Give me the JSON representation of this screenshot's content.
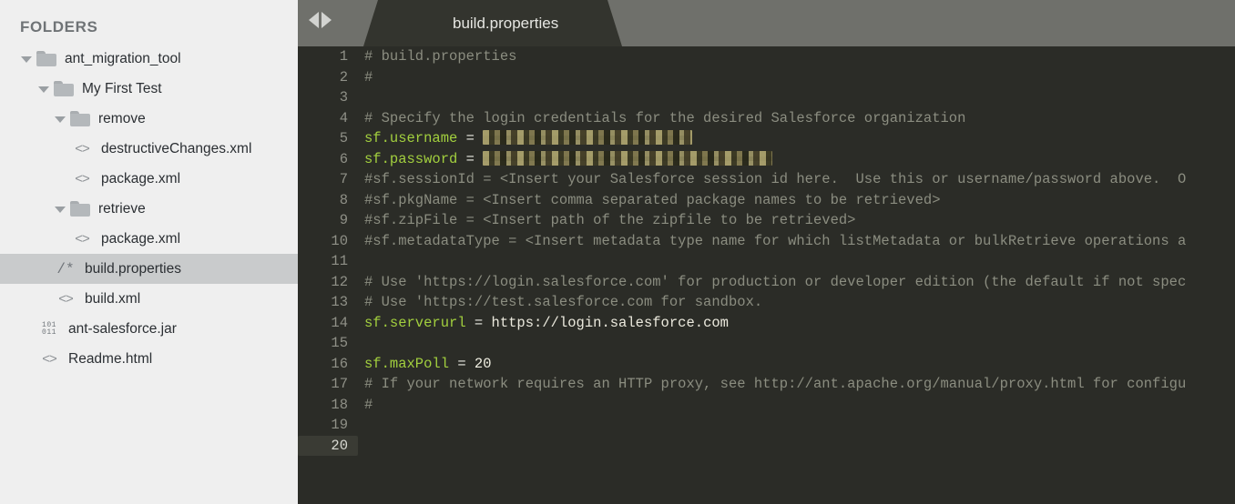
{
  "sidebar": {
    "title": "FOLDERS",
    "items": [
      {
        "label": "ant_migration_tool",
        "icon": "folder-icon",
        "indent": 0,
        "type": "folder",
        "expanded": true,
        "selected": false
      },
      {
        "label": "My First Test",
        "icon": "folder-icon",
        "indent": 1,
        "type": "folder",
        "expanded": true,
        "selected": false
      },
      {
        "label": "remove",
        "icon": "folder-icon",
        "indent": 2,
        "type": "folder",
        "expanded": true,
        "selected": false
      },
      {
        "label": "destructiveChanges.xml",
        "icon": "code-file-icon",
        "indent": 3,
        "type": "file",
        "expanded": false,
        "selected": false
      },
      {
        "label": "package.xml",
        "icon": "code-file-icon",
        "indent": 3,
        "type": "file",
        "expanded": false,
        "selected": false
      },
      {
        "label": "retrieve",
        "icon": "folder-icon",
        "indent": 2,
        "type": "folder",
        "expanded": true,
        "selected": false
      },
      {
        "label": "package.xml",
        "icon": "code-file-icon",
        "indent": 3,
        "type": "file",
        "expanded": false,
        "selected": false
      },
      {
        "label": "build.properties",
        "icon": "properties-file-icon",
        "indent": 2,
        "type": "file",
        "expanded": false,
        "selected": true
      },
      {
        "label": "build.xml",
        "icon": "code-file-icon",
        "indent": 2,
        "type": "file",
        "expanded": false,
        "selected": false
      },
      {
        "label": "ant-salesforce.jar",
        "icon": "binary-file-icon",
        "indent": 1,
        "type": "file",
        "expanded": false,
        "selected": false
      },
      {
        "label": "Readme.html",
        "icon": "code-file-icon",
        "indent": 1,
        "type": "file",
        "expanded": false,
        "selected": false
      }
    ],
    "icon_glyphs": {
      "code-file-icon": "<>",
      "properties-file-icon": "/*",
      "binary-file-icon_top": "101",
      "binary-file-icon_bottom": "011"
    }
  },
  "tabbar": {
    "nav_prev_icon": "arrow-left-icon",
    "nav_next_icon": "arrow-right-icon",
    "tabs": [
      {
        "label": "build.properties",
        "active": true,
        "close_icon": "×"
      }
    ]
  },
  "editor": {
    "active_line": 20,
    "line_numbers": [
      1,
      2,
      3,
      4,
      5,
      6,
      7,
      8,
      9,
      10,
      11,
      12,
      13,
      14,
      15,
      16,
      17,
      18,
      19,
      20
    ],
    "lines": [
      {
        "n": 1,
        "tokens": [
          {
            "t": "comment",
            "v": "# build.properties"
          }
        ]
      },
      {
        "n": 2,
        "tokens": [
          {
            "t": "comment",
            "v": "#"
          }
        ]
      },
      {
        "n": 3,
        "tokens": []
      },
      {
        "n": 4,
        "tokens": [
          {
            "t": "comment",
            "v": "# Specify the login credentials for the desired Salesforce organization"
          }
        ]
      },
      {
        "n": 5,
        "tokens": [
          {
            "t": "key",
            "v": "sf.username"
          },
          {
            "t": "eq",
            "v": " = "
          },
          {
            "t": "redacted",
            "v": "",
            "width": "user"
          }
        ]
      },
      {
        "n": 6,
        "tokens": [
          {
            "t": "key",
            "v": "sf.password"
          },
          {
            "t": "eq",
            "v": " = "
          },
          {
            "t": "redacted",
            "v": "",
            "width": "pass"
          }
        ]
      },
      {
        "n": 7,
        "tokens": [
          {
            "t": "comment",
            "v": "#sf.sessionId = <Insert your Salesforce session id here.  Use this or username/password above.  O"
          }
        ]
      },
      {
        "n": 8,
        "tokens": [
          {
            "t": "comment",
            "v": "#sf.pkgName = <Insert comma separated package names to be retrieved>"
          }
        ]
      },
      {
        "n": 9,
        "tokens": [
          {
            "t": "comment",
            "v": "#sf.zipFile = <Insert path of the zipfile to be retrieved>"
          }
        ]
      },
      {
        "n": 10,
        "tokens": [
          {
            "t": "comment",
            "v": "#sf.metadataType = <Insert metadata type name for which listMetadata or bulkRetrieve operations a"
          }
        ]
      },
      {
        "n": 11,
        "tokens": []
      },
      {
        "n": 12,
        "tokens": [
          {
            "t": "comment",
            "v": "# Use 'https://login.salesforce.com' for production or developer edition (the default if not spec"
          }
        ]
      },
      {
        "n": 13,
        "tokens": [
          {
            "t": "comment",
            "v": "# Use 'https://test.salesforce.com for sandbox."
          }
        ]
      },
      {
        "n": 14,
        "tokens": [
          {
            "t": "key",
            "v": "sf.serverurl"
          },
          {
            "t": "eq",
            "v": " = "
          },
          {
            "t": "value",
            "v": "https://login.salesforce.com"
          }
        ]
      },
      {
        "n": 15,
        "tokens": []
      },
      {
        "n": 16,
        "tokens": [
          {
            "t": "key",
            "v": "sf.maxPoll"
          },
          {
            "t": "eq",
            "v": " = "
          },
          {
            "t": "number",
            "v": "20"
          }
        ]
      },
      {
        "n": 17,
        "tokens": [
          {
            "t": "comment",
            "v": "# If your network requires an HTTP proxy, see http://ant.apache.org/manual/proxy.html for configu"
          }
        ]
      },
      {
        "n": 18,
        "tokens": [
          {
            "t": "comment",
            "v": "#"
          }
        ]
      },
      {
        "n": 19,
        "tokens": []
      },
      {
        "n": 20,
        "tokens": []
      }
    ]
  },
  "colors": {
    "sidebar_bg": "#efefef",
    "sidebar_selected": "#c9cbcc",
    "tabbar_bg": "#6f706b",
    "tab_active_bg": "#33342e",
    "editor_bg": "#2b2c27",
    "keyword_green": "#a2cf3e",
    "comment_gray": "#8b8d80",
    "value_text": "#eceade",
    "gutter_text": "#8f9087",
    "active_line_bg": "#3a3b34"
  }
}
